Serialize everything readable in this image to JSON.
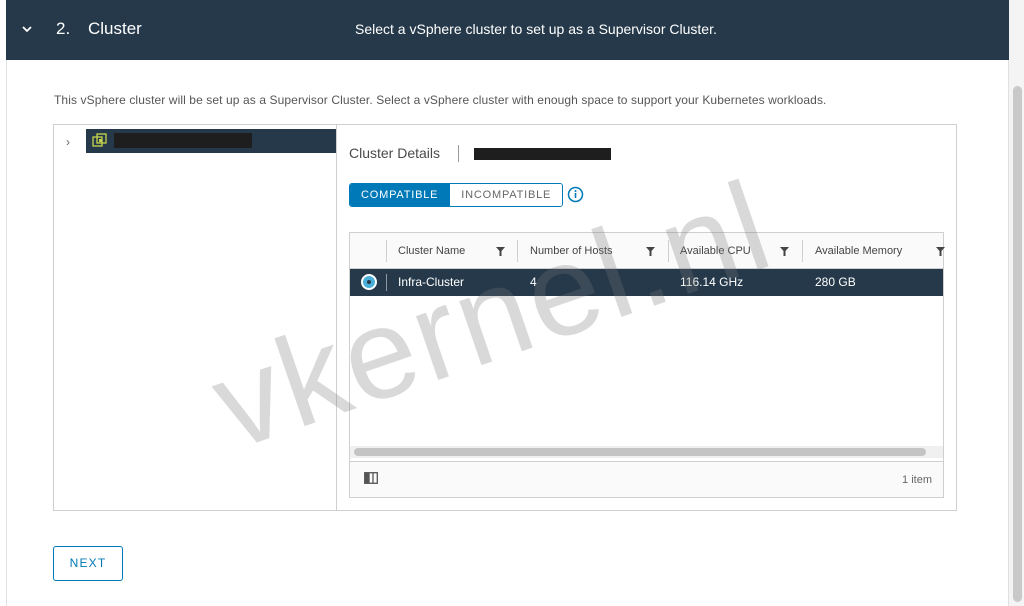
{
  "header": {
    "step_number": "2.",
    "title": "Cluster",
    "subtitle": "Select a vSphere cluster to set up as a Supervisor Cluster."
  },
  "description": "This vSphere cluster will be set up as a Supervisor Cluster. Select a vSphere cluster with enough space to support your Kubernetes workloads.",
  "details": {
    "label": "Cluster Details"
  },
  "tabs": {
    "compatible": "COMPATIBLE",
    "incompatible": "INCOMPATIBLE"
  },
  "grid": {
    "columns": [
      "Cluster Name",
      "Number of Hosts",
      "Available CPU",
      "Available Memory"
    ],
    "rows": [
      {
        "name": "Infra-Cluster",
        "hosts": "4",
        "cpu": "116.14 GHz",
        "memory": "280 GB"
      }
    ],
    "footer": "1 item"
  },
  "next_button": "NEXT",
  "watermark": "vkernel.nl",
  "colors": {
    "header_bg": "#25394a",
    "accent": "#0079b8",
    "selected_row": "#25394a"
  }
}
